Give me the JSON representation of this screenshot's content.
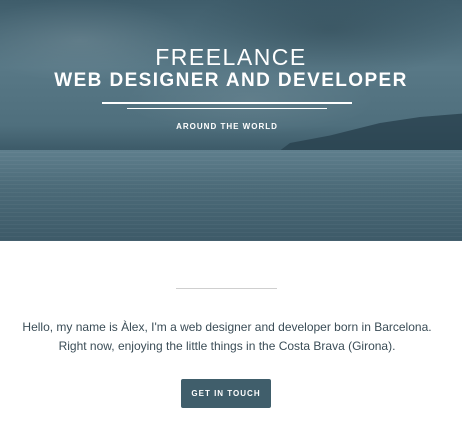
{
  "hero": {
    "title_line1": "FREELANCE",
    "title_line2": "WEB DESIGNER AND DEVELOPER",
    "subtitle": "AROUND THE WORLD"
  },
  "intro": {
    "line1": "Hello, my name is Àlex, I'm a web designer and developer born in Barcelona.",
    "line2": "Right now, enjoying the little things in the Costa Brava (Girona)."
  },
  "cta": {
    "label": "GET IN TOUCH"
  },
  "colors": {
    "button_bg": "#405e6b",
    "body_text": "#3b4d57",
    "divider": "#cfcfcf"
  }
}
